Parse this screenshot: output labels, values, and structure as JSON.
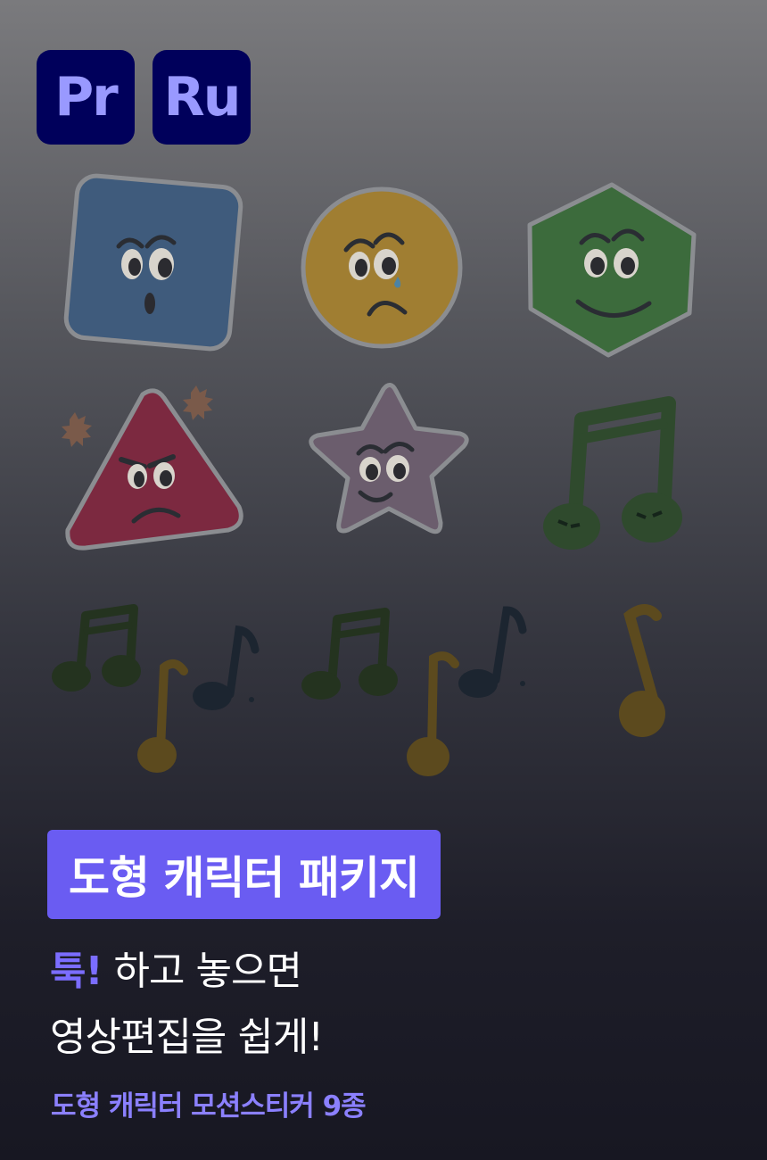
{
  "badges": {
    "premiere": "Pr",
    "rush": "Ru"
  },
  "characters": [
    {
      "shape": "square",
      "expression": "surprised",
      "color": "#3f5b7c"
    },
    {
      "shape": "circle",
      "expression": "crying",
      "color": "#a07e32"
    },
    {
      "shape": "hexagon",
      "expression": "smiling",
      "color": "#3c6b3c"
    },
    {
      "shape": "triangle",
      "expression": "angry",
      "color": "#7c2940"
    },
    {
      "shape": "star",
      "expression": "smirk",
      "color": "#6b5d6d"
    },
    {
      "shape": "beamed-note",
      "expression": "angry",
      "color": "#2f4a2d"
    }
  ],
  "headline": {
    "title": "도형 캐릭터 패키지",
    "line1_accent": "툭!",
    "line1_rest": " 하고 놓으면",
    "line2": "영상편집을 쉽게!",
    "subtitle": "도형 캐릭터 모션스티커 9종"
  },
  "colors": {
    "accent": "#6a5cf2",
    "badge_bg": "#00005b",
    "badge_text": "#9999ff"
  }
}
